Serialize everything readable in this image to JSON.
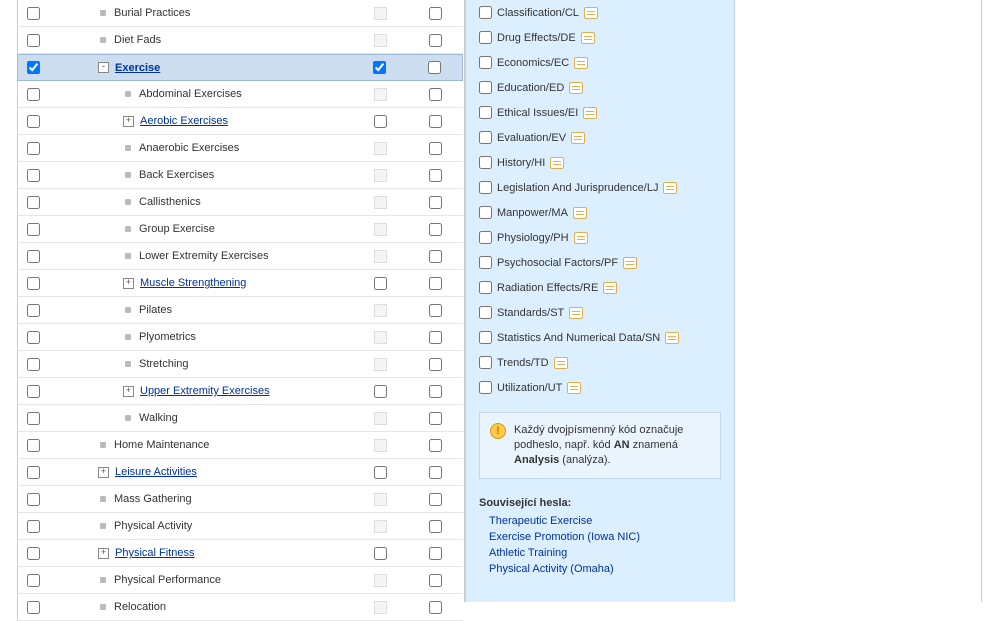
{
  "tree": [
    {
      "indent": 2,
      "exp": "",
      "dot": true,
      "label": "Burial Practices",
      "link": false,
      "c1": false,
      "c2": "disabled",
      "c3": false,
      "sel": false
    },
    {
      "indent": 2,
      "exp": "",
      "dot": true,
      "label": "Diet Fads",
      "link": false,
      "c1": false,
      "c2": "disabled",
      "c3": false,
      "sel": false
    },
    {
      "indent": 2,
      "exp": "-",
      "dot": false,
      "label": "Exercise",
      "link": true,
      "c1": true,
      "c2": "checked",
      "c3": false,
      "sel": true
    },
    {
      "indent": 3,
      "exp": "",
      "dot": true,
      "label": "Abdominal Exercises",
      "link": false,
      "c1": false,
      "c2": "disabled",
      "c3": false,
      "sel": false
    },
    {
      "indent": 3,
      "exp": "+",
      "dot": false,
      "label": "Aerobic Exercises",
      "link": true,
      "c1": false,
      "c2": "empty",
      "c3": false,
      "sel": false
    },
    {
      "indent": 3,
      "exp": "",
      "dot": true,
      "label": "Anaerobic Exercises",
      "link": false,
      "c1": false,
      "c2": "disabled",
      "c3": false,
      "sel": false
    },
    {
      "indent": 3,
      "exp": "",
      "dot": true,
      "label": "Back Exercises",
      "link": false,
      "c1": false,
      "c2": "disabled",
      "c3": false,
      "sel": false
    },
    {
      "indent": 3,
      "exp": "",
      "dot": true,
      "label": "Callisthenics",
      "link": false,
      "c1": false,
      "c2": "disabled",
      "c3": false,
      "sel": false
    },
    {
      "indent": 3,
      "exp": "",
      "dot": true,
      "label": "Group Exercise",
      "link": false,
      "c1": false,
      "c2": "disabled",
      "c3": false,
      "sel": false
    },
    {
      "indent": 3,
      "exp": "",
      "dot": true,
      "label": "Lower Extremity Exercises",
      "link": false,
      "c1": false,
      "c2": "disabled",
      "c3": false,
      "sel": false
    },
    {
      "indent": 3,
      "exp": "+",
      "dot": false,
      "label": "Muscle Strengthening",
      "link": true,
      "c1": false,
      "c2": "empty",
      "c3": false,
      "sel": false
    },
    {
      "indent": 3,
      "exp": "",
      "dot": true,
      "label": "Pilates",
      "link": false,
      "c1": false,
      "c2": "disabled",
      "c3": false,
      "sel": false
    },
    {
      "indent": 3,
      "exp": "",
      "dot": true,
      "label": "Plyometrics",
      "link": false,
      "c1": false,
      "c2": "disabled",
      "c3": false,
      "sel": false
    },
    {
      "indent": 3,
      "exp": "",
      "dot": true,
      "label": "Stretching",
      "link": false,
      "c1": false,
      "c2": "disabled",
      "c3": false,
      "sel": false
    },
    {
      "indent": 3,
      "exp": "+",
      "dot": false,
      "label": "Upper Extremity Exercises",
      "link": true,
      "c1": false,
      "c2": "empty",
      "c3": false,
      "sel": false
    },
    {
      "indent": 3,
      "exp": "",
      "dot": true,
      "label": "Walking",
      "link": false,
      "c1": false,
      "c2": "disabled",
      "c3": false,
      "sel": false
    },
    {
      "indent": 2,
      "exp": "",
      "dot": true,
      "label": "Home Maintenance",
      "link": false,
      "c1": false,
      "c2": "disabled",
      "c3": false,
      "sel": false
    },
    {
      "indent": 2,
      "exp": "+",
      "dot": false,
      "label": "Leisure Activities",
      "link": true,
      "c1": false,
      "c2": "empty",
      "c3": false,
      "sel": false
    },
    {
      "indent": 2,
      "exp": "",
      "dot": true,
      "label": "Mass Gathering",
      "link": false,
      "c1": false,
      "c2": "disabled",
      "c3": false,
      "sel": false
    },
    {
      "indent": 2,
      "exp": "",
      "dot": true,
      "label": "Physical Activity",
      "link": false,
      "c1": false,
      "c2": "disabled",
      "c3": false,
      "sel": false
    },
    {
      "indent": 2,
      "exp": "+",
      "dot": false,
      "label": "Physical Fitness",
      "link": true,
      "c1": false,
      "c2": "empty",
      "c3": false,
      "sel": false
    },
    {
      "indent": 2,
      "exp": "",
      "dot": true,
      "label": "Physical Performance",
      "link": false,
      "c1": false,
      "c2": "disabled",
      "c3": false,
      "sel": false
    },
    {
      "indent": 2,
      "exp": "",
      "dot": true,
      "label": "Relocation",
      "link": false,
      "c1": false,
      "c2": "disabled",
      "c3": false,
      "sel": false
    }
  ],
  "subheadings": [
    "Classification/CL",
    "Drug Effects/DE",
    "Economics/EC",
    "Education/ED",
    "Ethical Issues/EI",
    "Evaluation/EV",
    "History/HI",
    "Legislation And Jurisprudence/LJ",
    "Manpower/MA",
    "Physiology/PH",
    "Psychosocial Factors/PF",
    "Radiation Effects/RE",
    "Standards/ST",
    "Statistics And Numerical Data/SN",
    "Trends/TD",
    "Utilization/UT"
  ],
  "info": {
    "part1": "Každý dvojpísmenný kód označuje podheslo, např. kód ",
    "code": "AN",
    "part2": " znamená ",
    "bold": "Analysis",
    "part3": " (analýza)."
  },
  "related_title": "Související hesla:",
  "related": [
    "Therapeutic Exercise",
    "Exercise Promotion (Iowa NIC)",
    "Athletic Training",
    "Physical Activity (Omaha)"
  ]
}
